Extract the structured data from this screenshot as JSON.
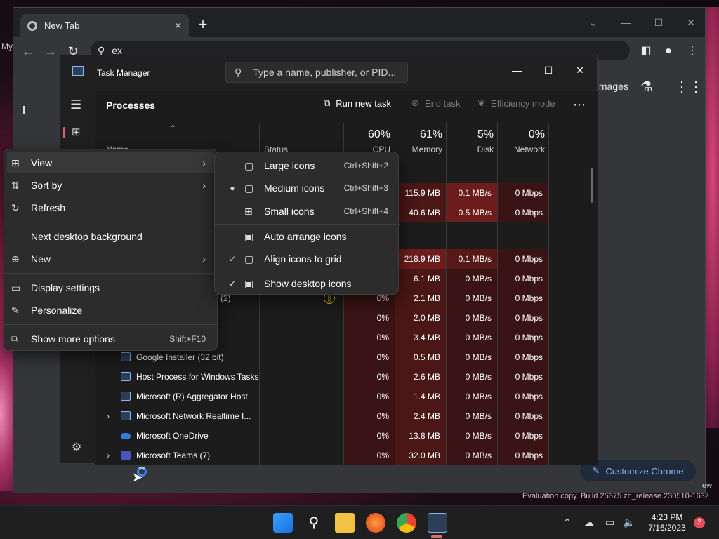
{
  "chrome": {
    "tab_title": "New Tab",
    "omnibox_value": "ex",
    "images_link": "Images",
    "customize_label": "Customize Chrome",
    "left_text": "My",
    "partial_right_text": "ew"
  },
  "task_manager": {
    "title": "Task Manager",
    "search_placeholder": "Type a name, publisher, or PID...",
    "heading": "Processes",
    "commands": {
      "run_new_task": "Run new task",
      "end_task": "End task",
      "efficiency_mode": "Efficiency mode"
    },
    "columns": {
      "name": "Name",
      "status": "Status",
      "cpu": {
        "pct": "60%",
        "label": "CPU"
      },
      "memory": {
        "pct": "61%",
        "label": "Memory"
      },
      "disk": {
        "pct": "5%",
        "label": "Disk"
      },
      "network": {
        "pct": "0%",
        "label": "Network"
      }
    },
    "rows": [
      {
        "name": "",
        "cpu": "",
        "memory": "115.9 MB",
        "disk": "0.1 MB/s",
        "network": "0 Mbps"
      },
      {
        "name": "",
        "cpu": "",
        "memory": "40.6 MB",
        "disk": "0.5 MB/s",
        "network": "0 Mbps"
      },
      {
        "name": "",
        "cpu": "",
        "memory": "218.9 MB",
        "disk": "0.1 MB/s",
        "network": "0 Mbps"
      },
      {
        "name": "",
        "cpu": "",
        "memory": "6.1 MB",
        "disk": "0 MB/s",
        "network": "0 Mbps"
      },
      {
        "name": "(2)",
        "cpu": "0%",
        "memory": "2.1 MB",
        "disk": "0 MB/s",
        "network": "0 Mbps"
      },
      {
        "name": "",
        "cpu": "0%",
        "memory": "2.0 MB",
        "disk": "0 MB/s",
        "network": "0 Mbps"
      },
      {
        "name": "",
        "cpu": "0%",
        "memory": "3.4 MB",
        "disk": "0 MB/s",
        "network": "0 Mbps"
      },
      {
        "name": "Google Installer (32 bit)",
        "cpu": "0%",
        "memory": "0.5 MB",
        "disk": "0 MB/s",
        "network": "0 Mbps"
      },
      {
        "name": "Host Process for Windows Tasks",
        "cpu": "0%",
        "memory": "2.6 MB",
        "disk": "0 MB/s",
        "network": "0 Mbps"
      },
      {
        "name": "Microsoft (R) Aggregator Host",
        "cpu": "0%",
        "memory": "1.4 MB",
        "disk": "0 MB/s",
        "network": "0 Mbps"
      },
      {
        "name": "Microsoft Network Realtime I...",
        "cpu": "0%",
        "memory": "2.4 MB",
        "disk": "0 MB/s",
        "network": "0 Mbps"
      },
      {
        "name": "Microsoft OneDrive",
        "cpu": "0%",
        "memory": "13.8 MB",
        "disk": "0 MB/s",
        "network": "0 Mbps"
      },
      {
        "name": "Microsoft Teams (7)",
        "cpu": "0%",
        "memory": "32.0 MB",
        "disk": "0 MB/s",
        "network": "0 Mbps"
      }
    ]
  },
  "desktop_menu": {
    "items": [
      {
        "label": "View"
      },
      {
        "label": "Sort by"
      },
      {
        "label": "Refresh"
      },
      {
        "label": "Next desktop background"
      },
      {
        "label": "New"
      },
      {
        "label": "Display settings"
      },
      {
        "label": "Personalize"
      },
      {
        "label": "Show more options",
        "shortcut": "Shift+F10"
      }
    ]
  },
  "view_submenu": {
    "items": [
      {
        "label": "Large icons",
        "shortcut": "Ctrl+Shift+2"
      },
      {
        "label": "Medium icons",
        "shortcut": "Ctrl+Shift+3"
      },
      {
        "label": "Small icons",
        "shortcut": "Ctrl+Shift+4"
      },
      {
        "label": "Auto arrange icons"
      },
      {
        "label": "Align icons to grid"
      },
      {
        "label": "Show desktop icons"
      }
    ]
  },
  "taskbar": {
    "time": "4:23 PM",
    "date": "7/16/2023",
    "notification_count": "2",
    "watermark": "Evaluation copy. Build 25375.zn_release.230510-1632"
  }
}
